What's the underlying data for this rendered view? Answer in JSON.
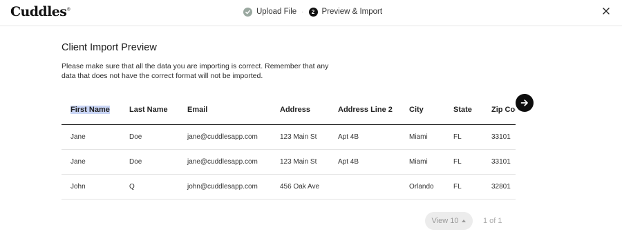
{
  "logo": {
    "text": "Cuddles",
    "mark": "®"
  },
  "steps": [
    {
      "label": "Upload File",
      "state": "done",
      "icon": "check-icon"
    },
    {
      "label": "Preview & Import",
      "state": "active",
      "number": "2"
    }
  ],
  "close_icon": "close-icon",
  "title": "Client Import Preview",
  "description": "Please make sure that all the data you are importing is correct. Remember that any data that does not have the correct format will not be imported.",
  "table": {
    "columns": [
      "First Name",
      "Last Name",
      "Email",
      "Address",
      "Address Line 2",
      "City",
      "State",
      "Zip Code"
    ],
    "rows": [
      [
        "Jane",
        "Doe",
        "jane@cuddlesapp.com",
        "123 Main St",
        "Apt 4B",
        "Miami",
        "FL",
        "33101"
      ],
      [
        "Jane",
        "Doe",
        "jane@cuddlesapp.com",
        "123 Main St",
        "Apt 4B",
        "Miami",
        "FL",
        "33101"
      ],
      [
        "John",
        "Q",
        "john@cuddlesapp.com",
        "456 Oak Ave",
        "",
        "Orlando",
        "FL",
        "32801"
      ]
    ]
  },
  "scroll_icon": "arrow-right-icon",
  "pagination": {
    "view_label": "View 10",
    "page_info": "1 of 1"
  },
  "colors": {
    "selection_highlight": "#c9d5f5",
    "step_done": "#9aa8a0",
    "scroll_button": "#0d0d0d"
  }
}
